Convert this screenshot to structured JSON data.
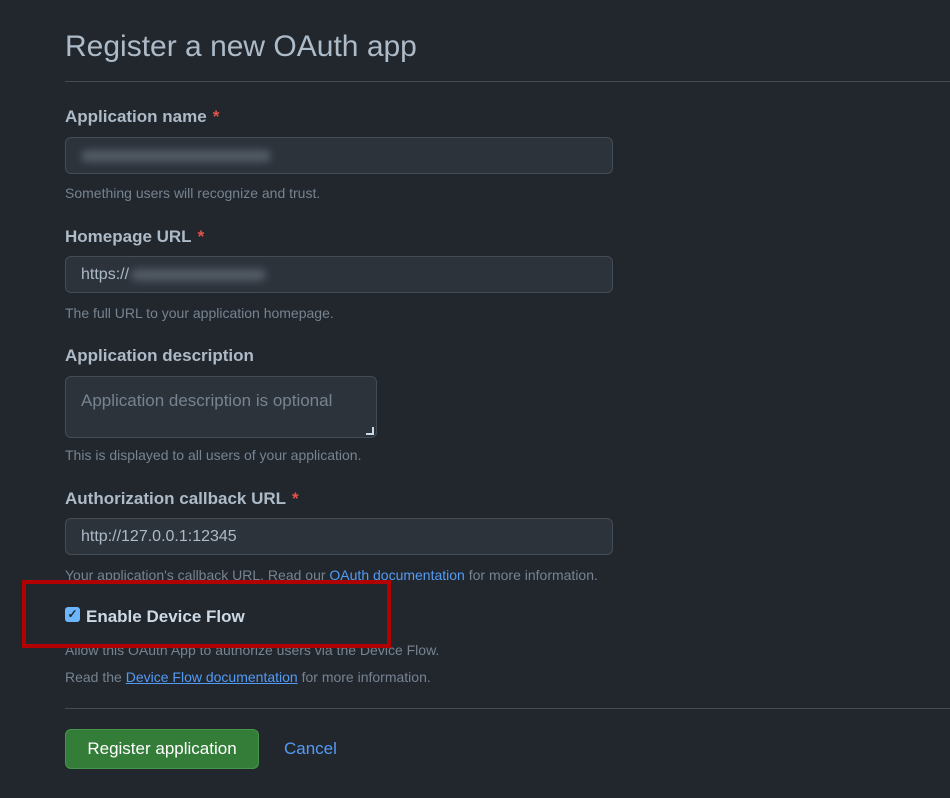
{
  "page": {
    "title": "Register a new OAuth app"
  },
  "colors": {
    "background": "#22272e",
    "accent": "#539bf5",
    "primary_button": "#347d39",
    "required": "#e5534b",
    "highlight_box": "#b00000"
  },
  "form": {
    "app_name": {
      "label": "Application name",
      "required_mark": "*",
      "value": "",
      "hint": "Something users will recognize and trust."
    },
    "homepage": {
      "label": "Homepage URL",
      "required_mark": "*",
      "value": "https://",
      "hint": "The full URL to your application homepage."
    },
    "description": {
      "label": "Application description",
      "placeholder": "Application description is optional",
      "hint": "This is displayed to all users of your application."
    },
    "callback": {
      "label": "Authorization callback URL",
      "required_mark": "*",
      "value": "http://127.0.0.1:12345",
      "hint_prefix": "Your application's callback URL. Read our ",
      "hint_link": "OAuth documentation",
      "hint_suffix": " for more information."
    },
    "device_flow": {
      "label": "Enable Device Flow",
      "checked": true,
      "hint1": "Allow this OAuth App to authorize users via the Device Flow.",
      "hint2_prefix": "Read the ",
      "hint2_link": "Device Flow documentation",
      "hint2_suffix": " for more information."
    }
  },
  "actions": {
    "register": "Register application",
    "cancel": "Cancel"
  }
}
